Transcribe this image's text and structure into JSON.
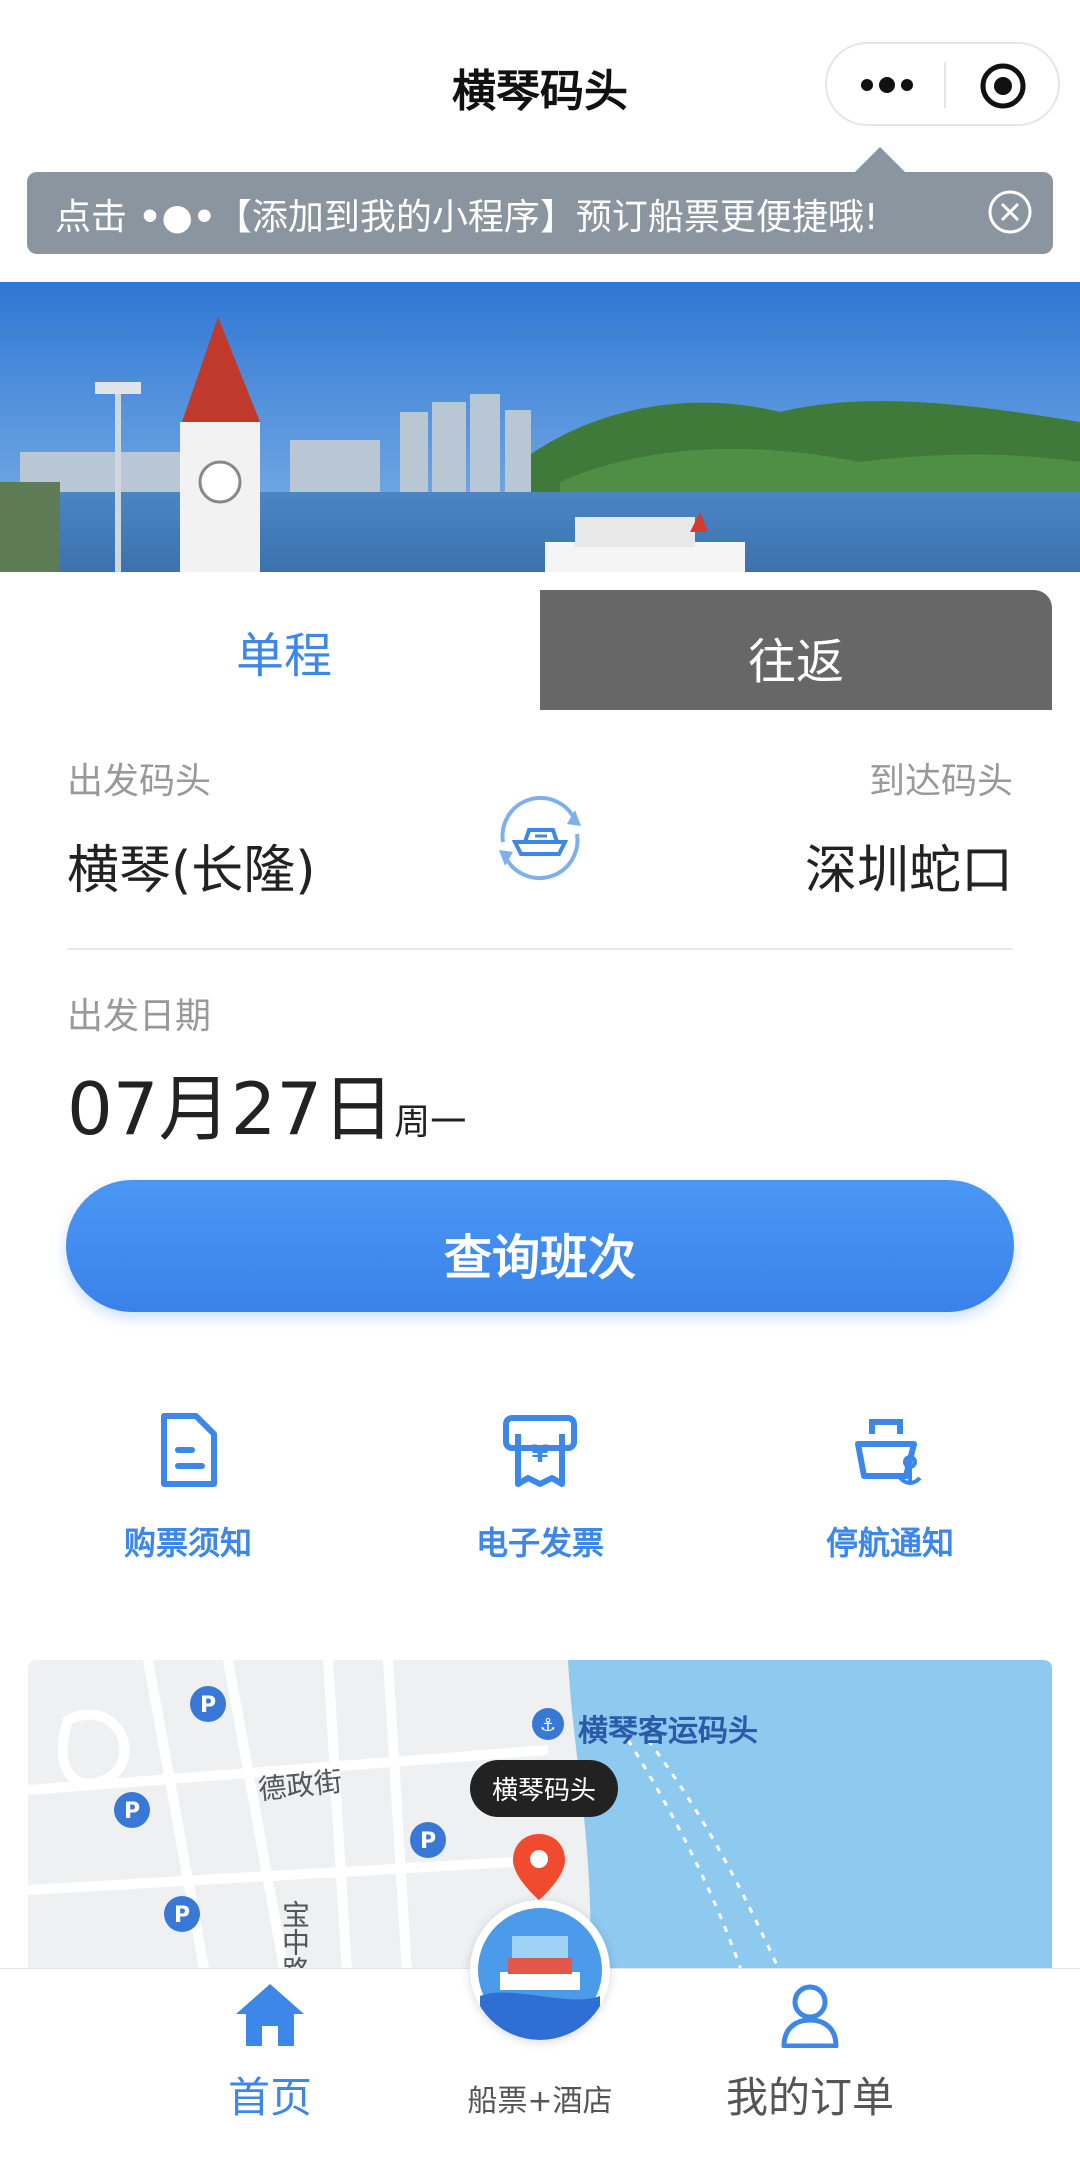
{
  "header": {
    "title": "横琴码头"
  },
  "tip": {
    "prefix": "点击",
    "dots": "•●•",
    "text": "【添加到我的小程序】预订船票更便捷哦!"
  },
  "tabs": {
    "single": "单程",
    "round": "往返"
  },
  "route": {
    "from_label": "出发码头",
    "from_port": "横琴(长隆)",
    "to_label": "到达码头",
    "to_port": "深圳蛇口"
  },
  "date": {
    "label": "出发日期",
    "value": "07月27日",
    "weekday": "周一"
  },
  "search_button": "查询班次",
  "features": {
    "notice": "购票须知",
    "invoice": "电子发票",
    "suspension": "停航通知"
  },
  "map": {
    "tag": "横琴码头",
    "labels": {
      "terminal": "横琴客运码头",
      "street1": "德政街",
      "street2": "宝中路"
    }
  },
  "nav": {
    "home": "首页",
    "hotel": "船票+酒店",
    "orders": "我的订单"
  },
  "colors": {
    "accent": "#3d87e8",
    "tip_bg": "#8b95a0"
  }
}
